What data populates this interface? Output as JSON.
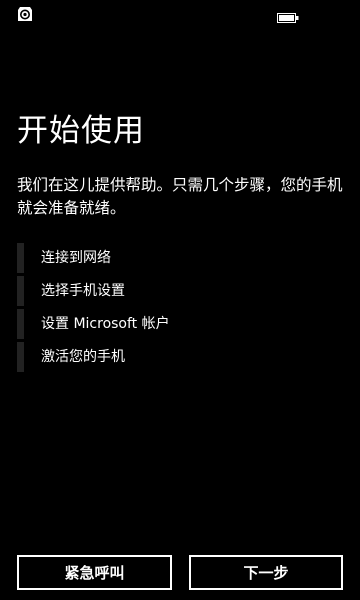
{
  "status_bar": {
    "left_icon": "sync-icon",
    "right_icon": "battery-icon"
  },
  "title": "开始使用",
  "intro": "我们在这儿提供帮助。只需几个步骤，您的手机就会准备就绪。",
  "steps": [
    {
      "label": "连接到网络"
    },
    {
      "label": "选择手机设置"
    },
    {
      "label": "设置 Microsoft 帐户"
    },
    {
      "label": "激活您的手机"
    }
  ],
  "buttons": {
    "emergency_label": "紧急呼叫",
    "next_label": "下一步"
  },
  "colors": {
    "background": "#000000",
    "text": "#ffffff",
    "step_marker": "#222222"
  }
}
